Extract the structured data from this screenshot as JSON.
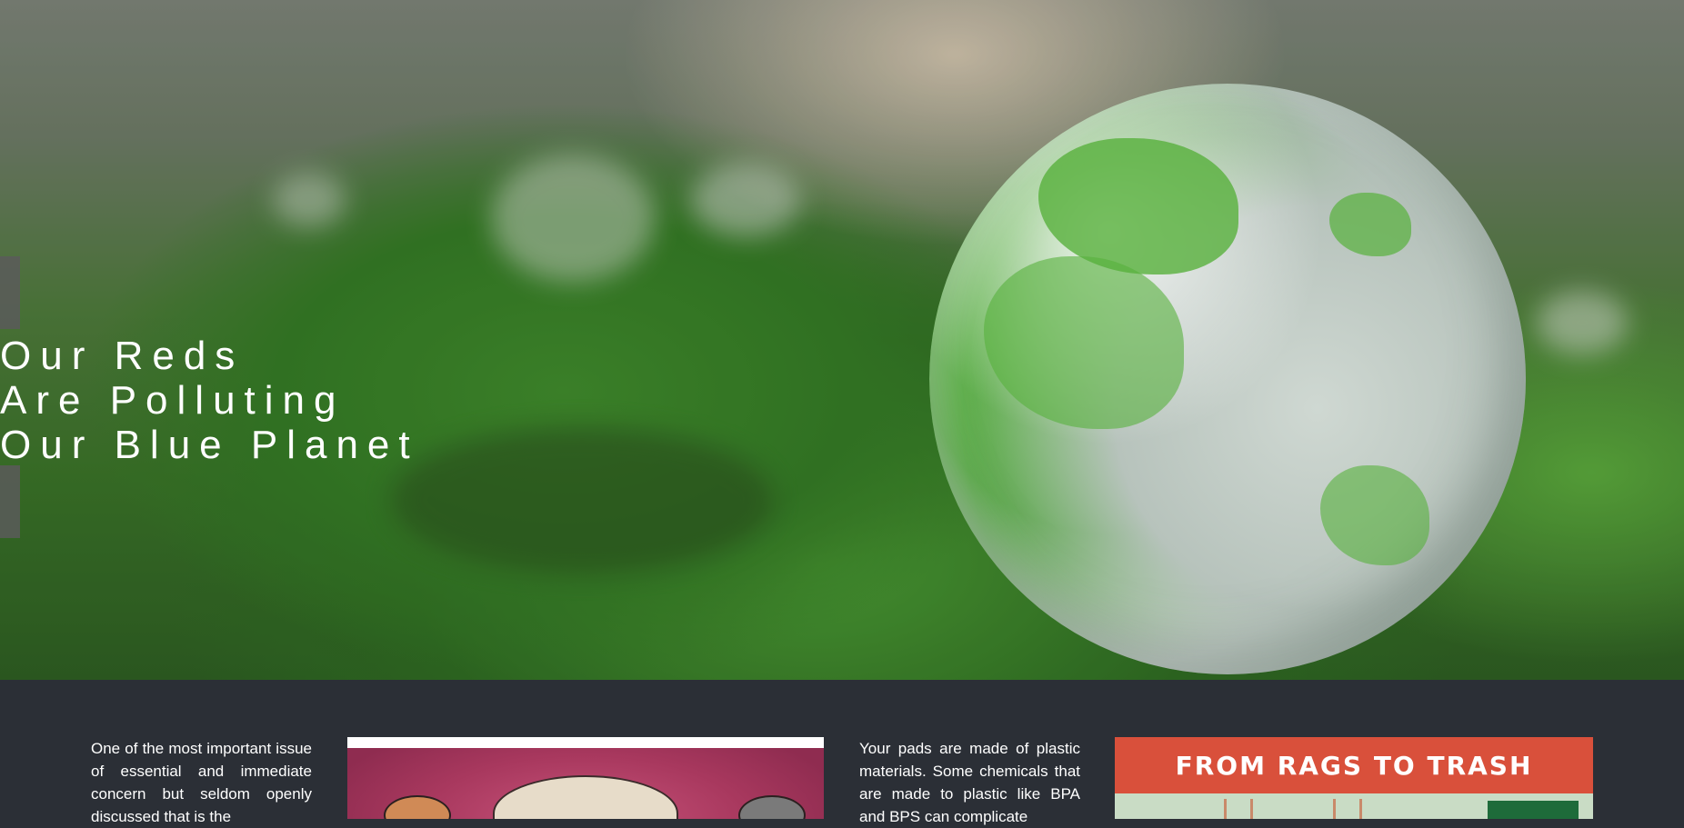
{
  "hero": {
    "title_lines": [
      "Our Reds",
      "Are Polluting",
      "Our Blue Planet"
    ]
  },
  "content": {
    "col1_text": "One of the most important issue of essential and immediate concern but seldom openly discussed that is the",
    "col2_text": "Your pads are made of plastic materials. Some chemicals that are made to plastic like BPA and BPS can complicate",
    "image2_banner": "FROM RAGS TO TRASH"
  },
  "colors": {
    "content_bg": "#2b2f36",
    "banner_red": "#d9503b",
    "text": "#ffffff"
  }
}
